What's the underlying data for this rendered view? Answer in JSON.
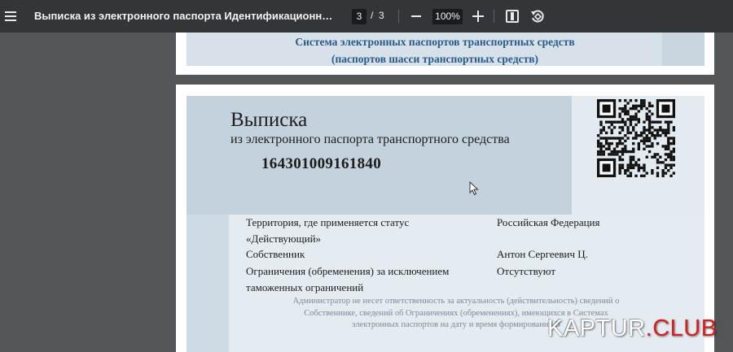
{
  "toolbar": {
    "title": "Выписка из электронного паспорта Идентификационный номер X...",
    "current_page": "3",
    "page_separator": "/",
    "total_pages": "3",
    "zoom": "100%",
    "icons": [
      "menu-icon",
      "zoom-out-icon",
      "zoom-in-icon",
      "fit-to-page-icon",
      "rotate-icon"
    ]
  },
  "prev_page": {
    "line1": "Система электронных паспортов транспортных средств",
    "line2": "(паспортов шасси транспортных средств)"
  },
  "document": {
    "title": "Выписка",
    "subtitle": "из электронного паспорта транспортного средства",
    "number": "164301009161840",
    "rows": [
      {
        "label_line1": "Территория, где применяется статус",
        "label_line2": "«Действующий»",
        "value": "Российская Федерация"
      },
      {
        "label_line1": "Собственник",
        "label_line2": "",
        "value": "Антон Сергеевич Ц."
      },
      {
        "label_line1": "Ограничения (обременения) за исключением",
        "label_line2": "таможенных ограничений",
        "value": "Отсутствуют"
      }
    ],
    "disclaimer_line1": "Администратор не несет ответственность за актуальность (действительность) сведений о",
    "disclaimer_line2": "Собственнике, сведений об Ограничениях (обременениях), имеющихся в Системах",
    "disclaimer_line3": "электронных паспортов на дату и время формирования В"
  },
  "watermark": {
    "part1": "KAPTUR",
    "part2": ".CLUB"
  },
  "colors": {
    "toolbar_bg": "#323639",
    "viewer_bg": "#525659",
    "doc_header_band": "#c3d2dd",
    "doc_info_panel": "#e4ebf1",
    "heading_blue": "#2b5a8a",
    "watermark_red": "#d62020"
  }
}
